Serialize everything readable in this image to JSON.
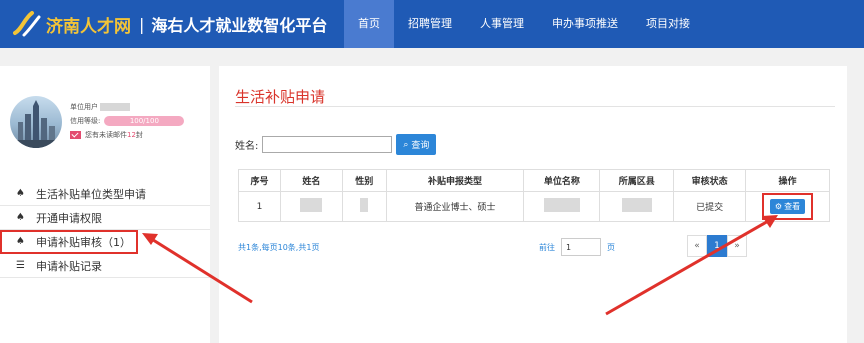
{
  "header": {
    "logo_title": "济南人才网",
    "separator": "|",
    "platform_name": "海右人才就业数智化平台",
    "nav": [
      "首页",
      "招聘管理",
      "人事管理",
      "申办事项推送",
      "项目对接"
    ]
  },
  "user": {
    "account_label": "单位用户",
    "credit_label": "信用等级:",
    "credit_value": "100/100",
    "credit_percent": 100,
    "mail_prefix": "您有未读邮件",
    "mail_count": "12",
    "mail_suffix": "封"
  },
  "menu": [
    {
      "icon": "home-icon",
      "glyph": "♠",
      "label": "生活补贴单位类型申请"
    },
    {
      "icon": "home-icon",
      "glyph": "♠",
      "label": "开通申请权限"
    },
    {
      "icon": "home-icon",
      "glyph": "♠",
      "label": "申请补贴审核（1）"
    },
    {
      "icon": "list-icon",
      "glyph": "☰",
      "label": "申请补贴记录"
    }
  ],
  "main": {
    "title": "生活补贴申请",
    "search_label": "姓名:",
    "search_value": "",
    "search_button": "查询",
    "columns": [
      "序号",
      "姓名",
      "性别",
      "补贴申报类型",
      "单位名称",
      "所属区县",
      "审核状态",
      "操作"
    ],
    "rows": [
      {
        "index": "1",
        "subsidy_type": "普通企业博士、硕士",
        "status": "已提交",
        "action": "查看"
      }
    ],
    "footer_count": "共1条,每页10条,共1页",
    "goto_prefix": "前往",
    "goto_value": "1",
    "goto_suffix": "页",
    "pager": {
      "prev": "«",
      "current": "1",
      "next": "»"
    }
  },
  "colors": {
    "header_bg": "#1f5ab5",
    "logo_yellow": "#f3c437",
    "accent_red": "#d9342b",
    "button_blue": "#2c86d8"
  }
}
